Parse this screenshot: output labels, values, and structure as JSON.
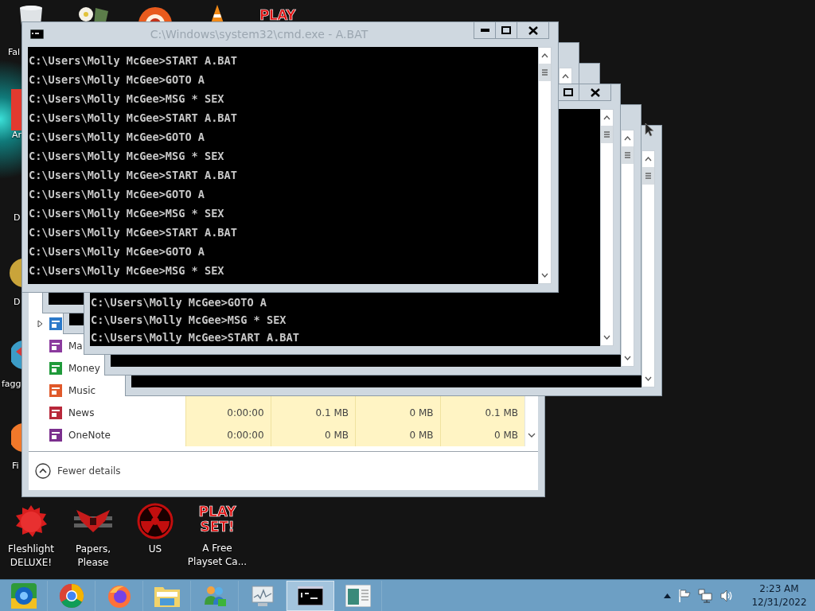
{
  "desktop": {
    "left_labels": [
      "Fal",
      "Ar",
      "D",
      "D",
      "fagg",
      "Fi"
    ],
    "top_logo": "PLAY",
    "bottom_icons": [
      {
        "kind": "fuzzball",
        "label": "Fleshlight DELUXE!"
      },
      {
        "kind": "emblem",
        "label": "Papers, Please"
      },
      {
        "kind": "radiation",
        "label": "US"
      },
      {
        "kind": "logo",
        "logo": "PLAY SET!",
        "label": "A Free Playset Ca..."
      }
    ]
  },
  "task_manager": {
    "rows": [
      {
        "kind": "mail",
        "expandable": true
      },
      {
        "kind": "maps",
        "name": "Ma",
        "expandable": false
      },
      {
        "kind": "money",
        "name": "Money",
        "expandable": false
      },
      {
        "kind": "music",
        "name": "Music",
        "expandable": false
      },
      {
        "kind": "news",
        "name": "News",
        "expandable": false,
        "cells": [
          "0:00:00",
          "0.1 MB",
          "0 MB",
          "0.1 MB"
        ]
      },
      {
        "kind": "onenote",
        "name": "OneNote",
        "expandable": false,
        "cells": [
          "0:00:00",
          "0 MB",
          "0 MB",
          "0 MB"
        ]
      }
    ],
    "footer": "Fewer details"
  },
  "consoles": [
    {
      "title": "C:\\Windows\\system32\\cmd.exe - A.BAT",
      "lines": [
        "C:\\Users\\Molly McGee>START A.BAT",
        "C:\\Users\\Molly McGee>GOTO A",
        "C:\\Users\\Molly McGee>MSG * SEX",
        "C:\\Users\\Molly McGee>START A.BAT",
        "C:\\Users\\Molly McGee>GOTO A",
        "C:\\Users\\Molly McGee>MSG * SEX",
        "C:\\Users\\Molly McGee>START A.BAT",
        "C:\\Users\\Molly McGee>GOTO A",
        "C:\\Users\\Molly McGee>MSG * SEX",
        "C:\\Users\\Molly McGee>START A.BAT",
        "C:\\Users\\Molly McGee>GOTO A",
        "C:\\Users\\Molly McGee>MSG * SEX"
      ]
    },
    {
      "lines": [
        "C:\\Users\\Molly McGee>GOTO A",
        "C:\\Users\\Molly McGee>MSG * SEX",
        "C:\\Users\\Molly McGee>START A.BAT"
      ]
    }
  ],
  "taskbar": {
    "items": [
      {
        "kind": "ie",
        "selected": false
      },
      {
        "kind": "chrome",
        "selected": false
      },
      {
        "kind": "firefox",
        "selected": false
      },
      {
        "kind": "explorer",
        "selected": false
      },
      {
        "kind": "messenger",
        "selected": false
      },
      {
        "kind": "monitor",
        "selected": false
      },
      {
        "kind": "cmd",
        "selected": true
      },
      {
        "kind": "window",
        "selected": false
      }
    ],
    "clock": {
      "time": "2:23 AM",
      "date": "12/31/2022"
    }
  }
}
